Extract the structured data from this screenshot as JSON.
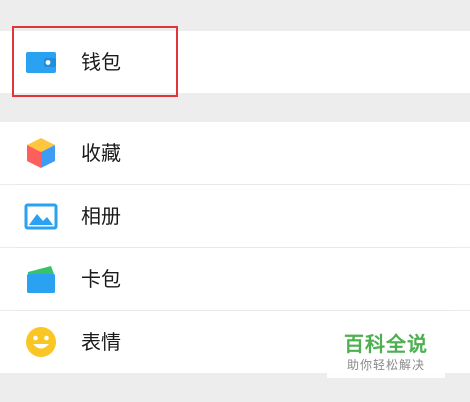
{
  "me_menu": {
    "wallet": {
      "label": "钱包",
      "icon": "wallet-icon"
    },
    "items": [
      {
        "label": "收藏",
        "icon": "favorites-cube-icon"
      },
      {
        "label": "相册",
        "icon": "album-picture-icon"
      },
      {
        "label": "卡包",
        "icon": "card-pack-icon"
      },
      {
        "label": "表情",
        "icon": "stickers-smiley-icon"
      }
    ]
  },
  "watermark": {
    "title": "百科全说",
    "subtitle": "助你轻松解决"
  },
  "colors": {
    "background": "#ededed",
    "row_background": "#ffffff",
    "highlight_border": "#e0353b",
    "wallet_blue": "#2aa1f1",
    "smiley_yellow": "#f9c623",
    "watermark_green": "#4caf50"
  }
}
